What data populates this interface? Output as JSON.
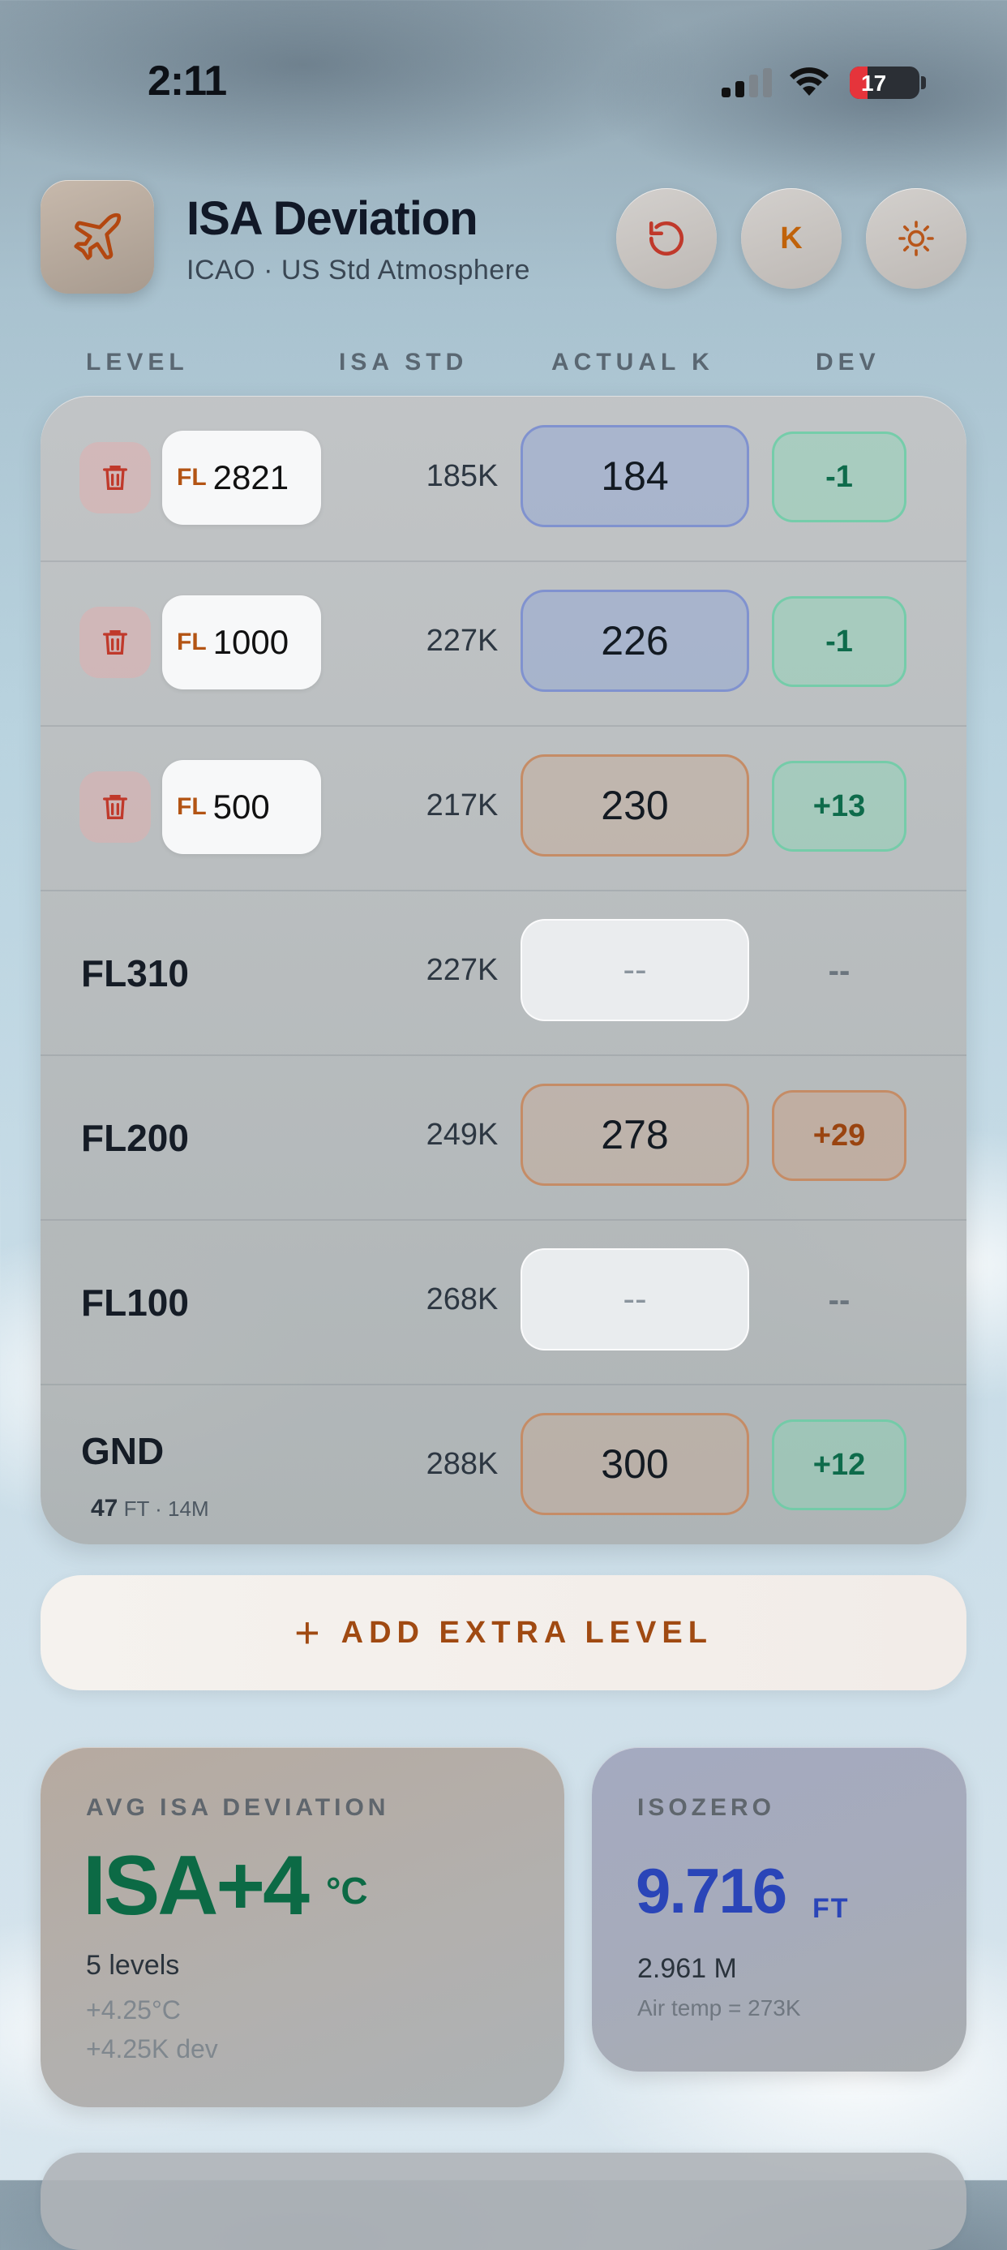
{
  "status_bar": {
    "time": "2:11",
    "battery": "17"
  },
  "header": {
    "title": "ISA Deviation",
    "subtitle": "ICAO · US Std Atmosphere",
    "unit_button": "K"
  },
  "columns": {
    "level": "LEVEL",
    "isa_std": "ISA STD",
    "actual": "ACTUAL K",
    "dev": "DEV"
  },
  "rows": [
    {
      "type": "custom",
      "prefix": "FL",
      "level": "2821",
      "isa": "185K",
      "actual": "184",
      "actual_style": "blue",
      "dev": "-1",
      "dev_style": "green"
    },
    {
      "type": "custom",
      "prefix": "FL",
      "level": "1000",
      "isa": "227K",
      "actual": "226",
      "actual_style": "blue",
      "dev": "-1",
      "dev_style": "green"
    },
    {
      "type": "custom",
      "prefix": "FL",
      "level": "500",
      "isa": "217K",
      "actual": "230",
      "actual_style": "orange",
      "dev": "+13",
      "dev_style": "green"
    },
    {
      "type": "fixed",
      "level": "FL310",
      "isa": "227K",
      "actual": "--",
      "actual_style": "empty",
      "dev": "--",
      "dev_style": "none"
    },
    {
      "type": "fixed",
      "level": "FL200",
      "isa": "249K",
      "actual": "278",
      "actual_style": "orange",
      "dev": "+29",
      "dev_style": "orange"
    },
    {
      "type": "fixed",
      "level": "FL100",
      "isa": "268K",
      "actual": "--",
      "actual_style": "empty",
      "dev": "--",
      "dev_style": "none"
    },
    {
      "type": "gnd",
      "level": "GND",
      "elev_ft": "47",
      "ft_unit": "FT",
      "elev_m": "· 14M",
      "isa": "288K",
      "actual": "300",
      "actual_style": "orange",
      "dev": "+12",
      "dev_style": "green"
    }
  ],
  "add_button": {
    "plus": "+",
    "label": "ADD EXTRA LEVEL"
  },
  "avg_card": {
    "heading": "AVG ISA DEVIATION",
    "value": "ISA+4",
    "unit": "°C",
    "levels": "5 levels",
    "dev_c": "+4.25°C",
    "dev_k": "+4.25K dev"
  },
  "iso_card": {
    "heading": "ISOZERO",
    "value": "9.716",
    "unit": "FT",
    "meters": "2.961 M",
    "air_temp": "Air temp = 273K"
  },
  "colors": {
    "accent_orange": "#c0620a",
    "green": "#0c6a45",
    "blue": "#2a45b8",
    "delete_red": "#c0392b"
  },
  "icons": [
    "airplane-icon",
    "reset-icon",
    "sun-icon",
    "trash-icon",
    "plus-icon",
    "signal-icon",
    "wifi-icon",
    "battery-icon"
  ]
}
